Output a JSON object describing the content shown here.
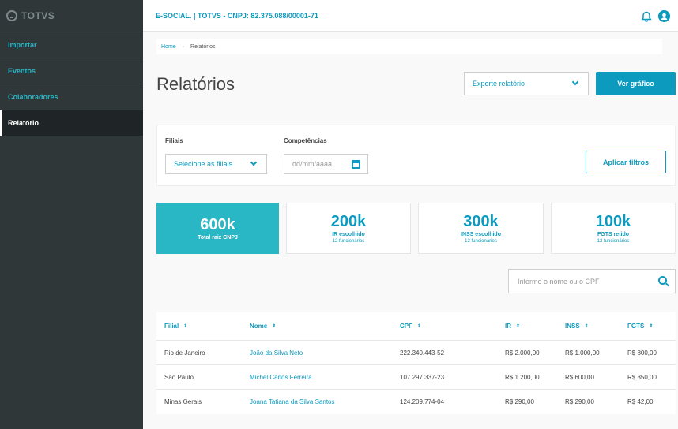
{
  "sidebar": {
    "brand": "TOTVS",
    "items": [
      {
        "label": "Importar"
      },
      {
        "label": "Eventos"
      },
      {
        "label": "Colaboradores"
      },
      {
        "label": "Relatório"
      }
    ]
  },
  "topbar": {
    "title": "E-SOCIAL. | TOTVS - CNPJ: 82.375.088/00001-71"
  },
  "breadcrumb": {
    "home": "Home",
    "current": "Relatórios"
  },
  "page": {
    "title": "Relatórios",
    "export_label": "Exporte relatório",
    "chart_button": "Ver gráfico"
  },
  "filters": {
    "branches_label": "Filiais",
    "branches_placeholder": "Selecione as filiais",
    "period_label": "Competências",
    "date_placeholder": "dd/mm/aaaa",
    "apply_button": "Aplicar filtros"
  },
  "kpis": [
    {
      "value": "600k",
      "label": "Total raiz CNPJ",
      "sub": ""
    },
    {
      "value": "200k",
      "label": "IR escolhido",
      "sub": "12 funcionários"
    },
    {
      "value": "300k",
      "label": "INSS escolhido",
      "sub": "12 funcionários"
    },
    {
      "value": "100k",
      "label": "FGTS retido",
      "sub": "12 funcionários"
    }
  ],
  "search": {
    "placeholder": "Informe o nome ou o CPF"
  },
  "table": {
    "headers": [
      "Filial",
      "Nome",
      "CPF",
      "IR",
      "INSS",
      "FGTS"
    ],
    "sort_glyph": "⇕",
    "rows": [
      [
        "Rio de Janeiro",
        "João da Silva Neto",
        "222.340.443-52",
        "R$ 2.000,00",
        "R$ 1.000,00",
        "R$ 800,00"
      ],
      [
        "São Paulo",
        "Michel Carlos Ferreira",
        "107.297.337-23",
        "R$ 1.200,00",
        "R$ 600,00",
        "R$ 350,00"
      ],
      [
        "Minas Gerais",
        "Joana Tatiana da Silva Santos",
        "124.209.774-04",
        "R$ 290,00",
        "R$ 290,00",
        "R$ 42,00"
      ]
    ]
  },
  "colors": {
    "accent": "#0c9abe",
    "highlight": "#29b6c5",
    "sidebar_bg": "#2f3738"
  },
  "icons": [
    "totvs-logo-icon",
    "bell-icon",
    "user-icon",
    "chevron-down-icon",
    "calendar-icon",
    "search-icon",
    "sort-icon"
  ]
}
